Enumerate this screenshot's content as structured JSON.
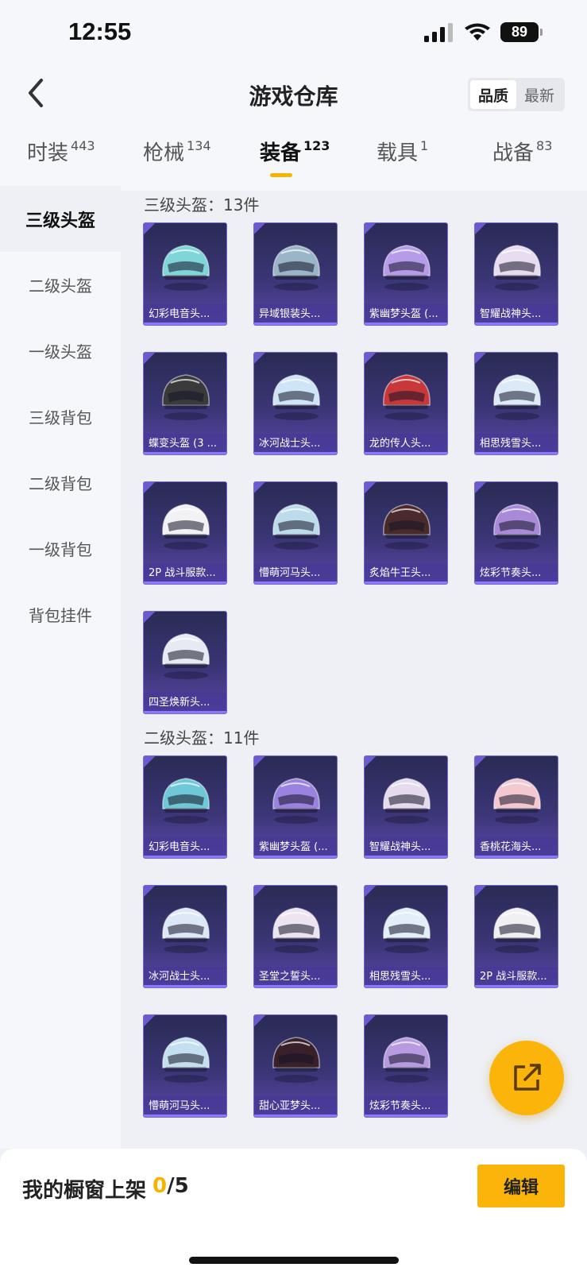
{
  "status": {
    "time": "12:55",
    "battery": "89"
  },
  "header": {
    "title": "游戏仓库",
    "sort": {
      "quality": "品质",
      "latest": "最新"
    }
  },
  "tabs": [
    {
      "label": "时装",
      "count": "443"
    },
    {
      "label": "枪械",
      "count": "134"
    },
    {
      "label": "装备",
      "count": "123"
    },
    {
      "label": "载具",
      "count": "1"
    },
    {
      "label": "战备",
      "count": "83"
    }
  ],
  "sidebar": [
    {
      "label": "三级头盔"
    },
    {
      "label": "二级头盔"
    },
    {
      "label": "一级头盔"
    },
    {
      "label": "三级背包"
    },
    {
      "label": "二级背包"
    },
    {
      "label": "一级背包"
    },
    {
      "label": "背包挂件"
    }
  ],
  "sections": [
    {
      "title": "三级头盔：13件",
      "items": [
        {
          "name": "幻彩电音头...",
          "color": "#7fd6d8"
        },
        {
          "name": "异域银装头...",
          "color": "#9ab4c8"
        },
        {
          "name": "紫幽梦头盔 (...",
          "color": "#b69be8"
        },
        {
          "name": "智耀战神头...",
          "color": "#e8dcf0"
        },
        {
          "name": "蝶变头盔 (3 ...",
          "color": "#3a3a3a"
        },
        {
          "name": "冰河战士头...",
          "color": "#cfe4f6"
        },
        {
          "name": "龙的传人头...",
          "color": "#c8383a"
        },
        {
          "name": "相思残雪头...",
          "color": "#dceaf8"
        },
        {
          "name": "2P 战斗服款...",
          "color": "#f2f2f4"
        },
        {
          "name": "懵萌河马头...",
          "color": "#bcdcec"
        },
        {
          "name": "炙焰牛王头...",
          "color": "#4a2a2a"
        },
        {
          "name": "炫彩节奏头...",
          "color": "#a88ad8"
        },
        {
          "name": "四圣焕新头...",
          "color": "#e6eaf2"
        }
      ]
    },
    {
      "title": "二级头盔：11件",
      "items": [
        {
          "name": "幻彩电音头...",
          "color": "#6fc8d6"
        },
        {
          "name": "紫幽梦头盔 (...",
          "color": "#9a82e0"
        },
        {
          "name": "智耀战神头...",
          "color": "#e4dcec"
        },
        {
          "name": "香桃花海头...",
          "color": "#f4c8d0"
        },
        {
          "name": "冰河战士头...",
          "color": "#dce8f6"
        },
        {
          "name": "圣堂之誓头...",
          "color": "#ece4f0"
        },
        {
          "name": "相思残雪头...",
          "color": "#e2eef8"
        },
        {
          "name": "2P 战斗服款...",
          "color": "#f0f0f2"
        },
        {
          "name": "懵萌河马头...",
          "color": "#c4e0f0"
        },
        {
          "name": "甜心亚梦头...",
          "color": "#3a2028"
        },
        {
          "name": "炫彩节奏头...",
          "color": "#b89ae0"
        }
      ]
    }
  ],
  "bottom": {
    "showcase_label": "我的橱窗上架",
    "current": "0",
    "total": "/5",
    "edit": "编辑"
  }
}
